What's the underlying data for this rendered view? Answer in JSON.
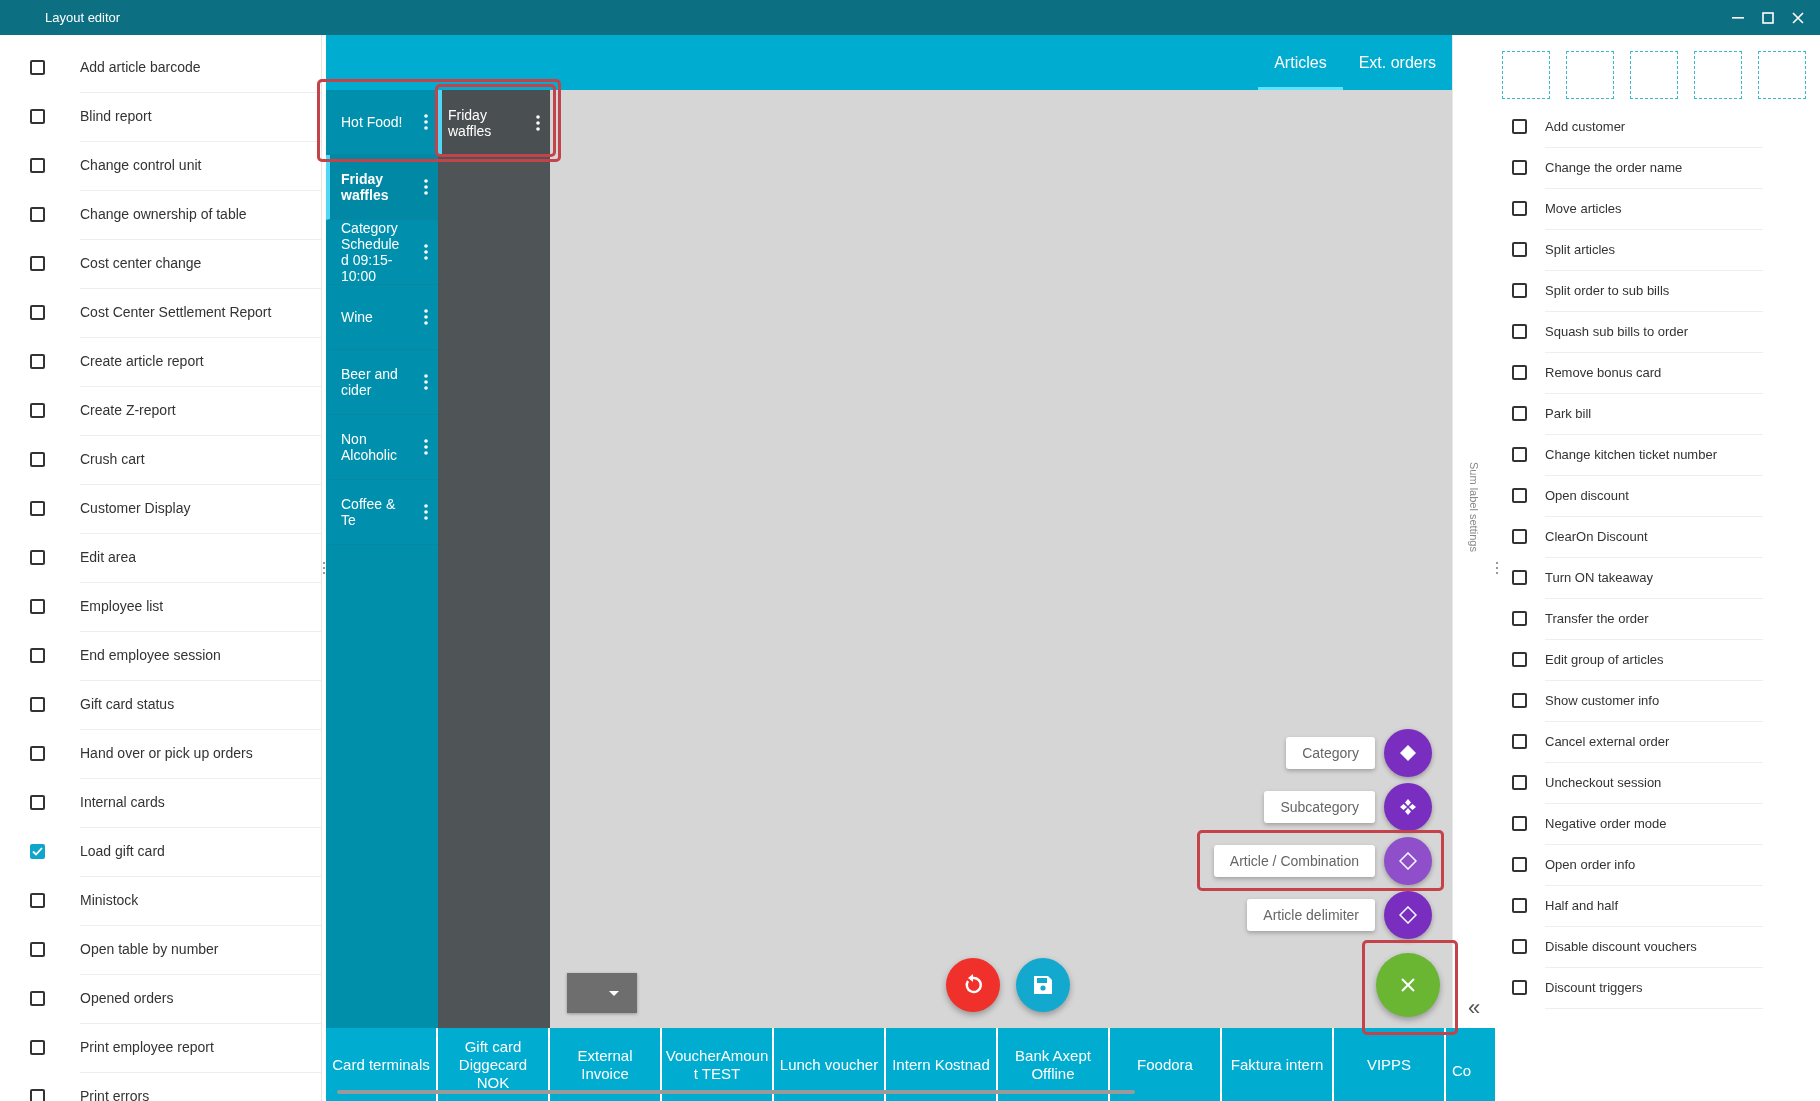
{
  "window": {
    "title": "Layout editor"
  },
  "left_functions": [
    {
      "label": "Add article barcode",
      "checked": false
    },
    {
      "label": "Blind report",
      "checked": false
    },
    {
      "label": "Change control unit",
      "checked": false
    },
    {
      "label": "Change ownership of table",
      "checked": false
    },
    {
      "label": "Cost center change",
      "checked": false
    },
    {
      "label": "Cost Center Settlement Report",
      "checked": false
    },
    {
      "label": "Create article report",
      "checked": false
    },
    {
      "label": "Create Z-report",
      "checked": false
    },
    {
      "label": "Crush cart",
      "checked": false
    },
    {
      "label": "Customer Display",
      "checked": false
    },
    {
      "label": "Edit area",
      "checked": false
    },
    {
      "label": "Employee list",
      "checked": false
    },
    {
      "label": "End employee session",
      "checked": false
    },
    {
      "label": "Gift card status",
      "checked": false
    },
    {
      "label": "Hand over or pick up orders",
      "checked": false
    },
    {
      "label": "Internal cards",
      "checked": false
    },
    {
      "label": "Load gift card",
      "checked": true
    },
    {
      "label": "Ministock",
      "checked": false
    },
    {
      "label": "Open table by number",
      "checked": false
    },
    {
      "label": "Opened orders",
      "checked": false
    },
    {
      "label": "Print employee report",
      "checked": false
    },
    {
      "label": "Print errors",
      "checked": false
    }
  ],
  "tabs": [
    {
      "label": "Articles",
      "selected": true
    },
    {
      "label": "Ext. orders",
      "selected": false
    }
  ],
  "categories": [
    {
      "label": "Hot Food!",
      "selected": false
    },
    {
      "label": "Friday waffles",
      "selected": true
    },
    {
      "label": "Category Scheduled 09:15-10:00",
      "selected": false
    },
    {
      "label": "Wine",
      "selected": false
    },
    {
      "label": "Beer and cider",
      "selected": false
    },
    {
      "label": "Non Alcoholic",
      "selected": false
    },
    {
      "label": "Coffee & Te",
      "selected": false
    }
  ],
  "subcategories": [
    {
      "label": "Friday waffles",
      "selected": true
    }
  ],
  "add_menu": [
    {
      "label": "Category",
      "kind": "category",
      "highlighted": false
    },
    {
      "label": "Subcategory",
      "kind": "subcategory",
      "highlighted": false
    },
    {
      "label": "Article / Combination",
      "kind": "article",
      "highlighted": true
    },
    {
      "label": "Article delimiter",
      "kind": "delimiter",
      "highlighted": false
    }
  ],
  "side_strip": {
    "label": "Sum label settings",
    "collapse": "«"
  },
  "payment_methods": [
    {
      "label": "Card terminals",
      "clipped": false
    },
    {
      "label": "Gift card Diggecard NOK",
      "clipped": false
    },
    {
      "label": "External Invoice",
      "clipped": false
    },
    {
      "label": "VoucherAmount TEST",
      "clipped": false
    },
    {
      "label": "Lunch voucher",
      "clipped": false
    },
    {
      "label": "Intern Kostnad",
      "clipped": false
    },
    {
      "label": "Bank Axept Offline",
      "clipped": false
    },
    {
      "label": "Foodora",
      "clipped": false
    },
    {
      "label": "Faktura intern",
      "clipped": false
    },
    {
      "label": "VIPPS",
      "clipped": false
    },
    {
      "label": "Co",
      "clipped": true
    }
  ],
  "right_functions": [
    {
      "label": "Add customer",
      "checked": false
    },
    {
      "label": "Change the order name",
      "checked": false
    },
    {
      "label": "Move articles",
      "checked": false
    },
    {
      "label": "Split articles",
      "checked": false
    },
    {
      "label": "Split order to sub bills",
      "checked": false
    },
    {
      "label": "Squash sub bills to order",
      "checked": false
    },
    {
      "label": "Remove bonus card",
      "checked": false
    },
    {
      "label": "Park bill",
      "checked": false
    },
    {
      "label": "Change kitchen ticket number",
      "checked": false
    },
    {
      "label": "Open discount",
      "checked": false
    },
    {
      "label": "ClearOn Discount",
      "checked": false
    },
    {
      "label": "Turn ON takeaway",
      "checked": false
    },
    {
      "label": "Transfer the order",
      "checked": false
    },
    {
      "label": "Edit group of articles",
      "checked": false
    },
    {
      "label": "Show customer info",
      "checked": false
    },
    {
      "label": "Cancel external order",
      "checked": false
    },
    {
      "label": "Uncheckout session",
      "checked": false
    },
    {
      "label": "Negative order mode",
      "checked": false
    },
    {
      "label": "Open order info",
      "checked": false
    },
    {
      "label": "Half and half",
      "checked": false
    },
    {
      "label": "Disable discount vouchers",
      "checked": false
    },
    {
      "label": "Discount triggers",
      "checked": false
    }
  ]
}
